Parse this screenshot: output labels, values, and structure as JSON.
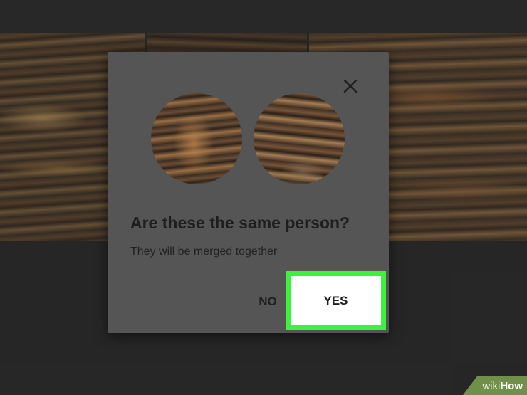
{
  "dialog": {
    "title": "Are these the same person?",
    "subtitle": "They will be merged together",
    "no_label": "NO",
    "yes_label": "YES"
  },
  "icons": {
    "close": "close-icon"
  },
  "colors": {
    "highlight": "#3df23a",
    "dialog_bg": "#555555",
    "watermark_bg": "#6f8f4a"
  },
  "watermark": {
    "part1": "wiki",
    "part2": "How"
  }
}
